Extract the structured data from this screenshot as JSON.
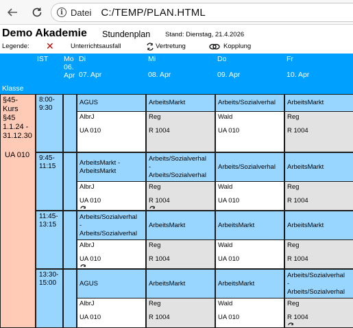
{
  "browser": {
    "scheme_label": "Datei",
    "url": "C:/TEMP/PLAN.HTML"
  },
  "page": {
    "title": "Demo Akademie",
    "subtitle": "Stundenplan",
    "stand": "Stand: Dienstag, 21.4.2026"
  },
  "legend": {
    "label": "Legende:",
    "ausfall": "Unterrichtsausfall",
    "vertretung": "Vertretung",
    "kopplung": "Kopplung"
  },
  "header": {
    "klasse": "Klasse",
    "ist": "IST",
    "mo": [
      "Mo",
      "06.",
      "Apr"
    ],
    "days": [
      {
        "name": "Di",
        "date": "07. Apr"
      },
      {
        "name": "Mi",
        "date": "08. Apr"
      },
      {
        "name": "Do",
        "date": "09. Apr"
      },
      {
        "name": "Fr",
        "date": "10. Apr"
      }
    ]
  },
  "klasse": {
    "lines": [
      "§45-",
      "Kurs",
      "§45",
      "1.1.24 -",
      "31.12.30"
    ],
    "room": "UA 010"
  },
  "colors": {
    "header_blue": "#00a0ff",
    "light_blue": "#99d6ff",
    "peach": "#ffcbb6",
    "grey": "#e2e2e2",
    "red_x": "#c00000"
  },
  "periods": [
    {
      "time": [
        "8:00-",
        "9:30"
      ],
      "cells": [
        {
          "subject": [
            "AGUS"
          ],
          "teacher": "AlbrJ",
          "room": "UA 010",
          "vertretung": false
        },
        {
          "subject": [
            "ArbeitsMarkt"
          ],
          "teacher": "Reg",
          "room": "R 1004",
          "vertretung": false
        },
        {
          "subject": [
            "Arbeits/Sozialverhal"
          ],
          "teacher": "Wald",
          "room": "UA 010",
          "vertretung": false
        },
        {
          "subject": [
            "ArbeitsMarkt"
          ],
          "teacher": "Reg",
          "room": "R 1004",
          "vertretung": false
        }
      ]
    },
    {
      "time": [
        "9:45-",
        "11:15"
      ],
      "cells": [
        {
          "subject": [
            "ArbeitsMarkt -",
            "ArbeitsMarkt"
          ],
          "teacher": "AlbrJ",
          "room": "UA 010",
          "vertretung": true
        },
        {
          "subject": [
            "Arbeits/Sozialverhal",
            "-",
            "Arbeits/Sozialverhal"
          ],
          "teacher": "Reg",
          "room": "R 1004",
          "vertretung": true
        },
        {
          "subject": [
            "Arbeits/Sozialverhal"
          ],
          "teacher": "Wald",
          "room": "UA 010",
          "vertretung": false
        },
        {
          "subject": [
            "ArbeitsMarkt"
          ],
          "teacher": "Reg",
          "room": "R 1004",
          "vertretung": false
        }
      ]
    },
    {
      "time": [
        "11:45-",
        "13:15"
      ],
      "cells": [
        {
          "subject": [
            "Arbeits/Sozialverhal",
            "-",
            "Arbeits/Sozialverhal"
          ],
          "teacher": "AlbrJ",
          "room": "UA 010",
          "vertretung": true
        },
        {
          "subject": [
            "ArbeitsMarkt"
          ],
          "teacher": "Reg",
          "room": "R 1004",
          "vertretung": false
        },
        {
          "subject": [
            "ArbeitsMarkt"
          ],
          "teacher": "Wald",
          "room": "UA 010",
          "vertretung": false
        },
        {
          "subject": [
            "ArbeitsMarkt"
          ],
          "teacher": "Reg",
          "room": "R 1004",
          "vertretung": false
        }
      ]
    },
    {
      "time": [
        "13:30-",
        "15:00"
      ],
      "cells": [
        {
          "subject": [
            "AGUS"
          ],
          "teacher": "AlbrJ",
          "room": "UA 010",
          "vertretung": false
        },
        {
          "subject": [
            "ArbeitsMarkt"
          ],
          "teacher": "Reg",
          "room": "R 1004",
          "vertretung": false
        },
        {
          "subject": [
            "ArbeitsMarkt"
          ],
          "teacher": "Wald",
          "room": "UA 010",
          "vertretung": false
        },
        {
          "subject": [
            "Arbeits/Sozialverhal",
            "-",
            "Arbeits/Sozialverhal"
          ],
          "teacher": "Reg",
          "room": "R 1004",
          "vertretung": true
        }
      ]
    }
  ]
}
